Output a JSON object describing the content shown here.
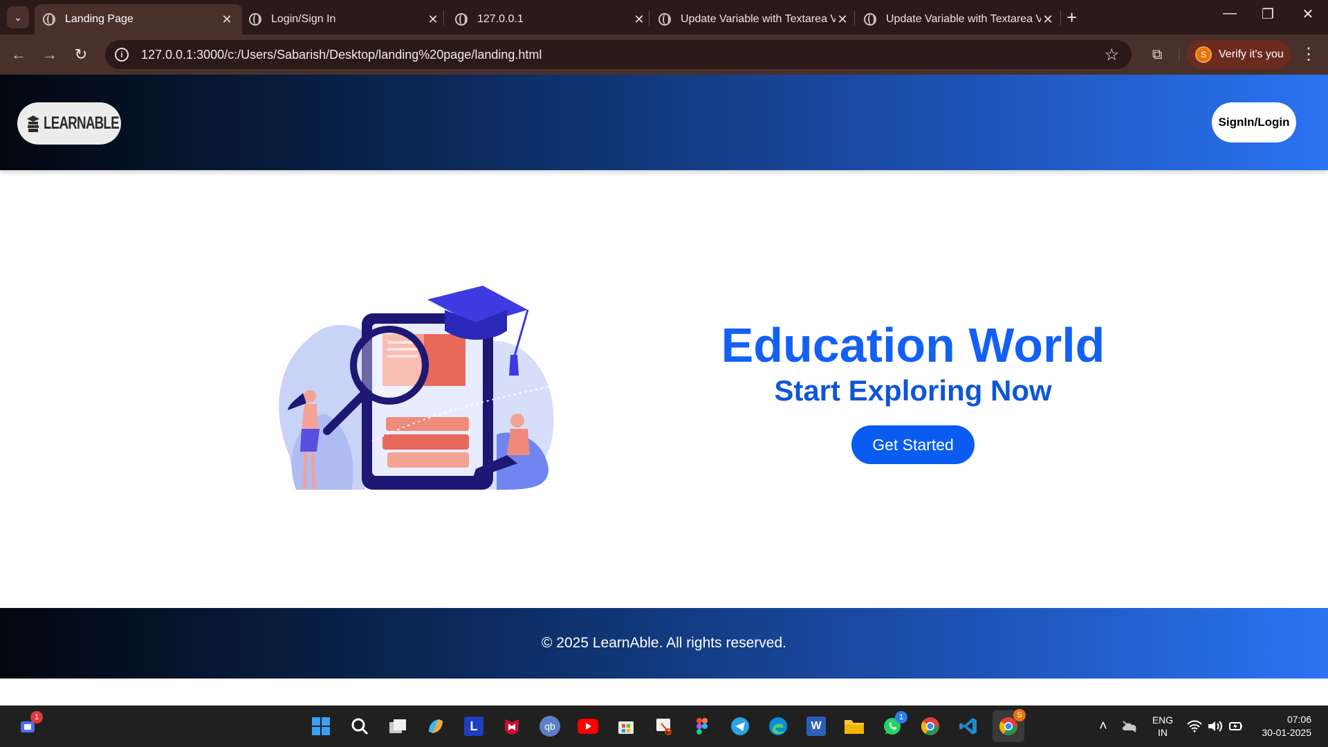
{
  "browser": {
    "tabs": [
      {
        "title": "Landing Page",
        "active": true
      },
      {
        "title": "Login/Sign In",
        "active": false
      },
      {
        "title": "127.0.0.1",
        "active": false
      },
      {
        "title": "Update Variable with Textarea V",
        "active": false
      },
      {
        "title": "Update Variable with Textarea V",
        "active": false
      }
    ],
    "new_tab_icon": "plus-icon",
    "url": "127.0.0.1:3000/c:/Users/Sabarish/Desktop/landing%20page/landing.html",
    "verify_label": "Verify it's you",
    "profile_initial": "S"
  },
  "page": {
    "logo_text": "LEARNABLE",
    "signin_label": "SignIn/Login",
    "hero_title": "Education World",
    "hero_subtitle": "Start Exploring Now",
    "cta_label": "Get Started",
    "footer_text": "© 2025 LearnAble. All rights reserved."
  },
  "taskbar": {
    "apps": [
      {
        "name": "teams",
        "badge": "1"
      },
      {
        "name": "start"
      },
      {
        "name": "search"
      },
      {
        "name": "task-view"
      },
      {
        "name": "copilot"
      },
      {
        "name": "l-app",
        "label": "L"
      },
      {
        "name": "mcafee"
      },
      {
        "name": "qbittorrent",
        "label": "qb"
      },
      {
        "name": "youtube"
      },
      {
        "name": "store"
      },
      {
        "name": "snipping-tool"
      },
      {
        "name": "figma"
      },
      {
        "name": "telegram"
      },
      {
        "name": "edge"
      },
      {
        "name": "word",
        "label": "W"
      },
      {
        "name": "file-explorer"
      },
      {
        "name": "whatsapp",
        "badge": "1"
      },
      {
        "name": "chrome"
      },
      {
        "name": "vscode"
      },
      {
        "name": "chrome-profile",
        "badge": "S"
      }
    ],
    "language": "ENG",
    "region": "IN",
    "time": "07:06",
    "date": "30-01-2025"
  },
  "colors": {
    "accent": "#1260f5",
    "button": "#0a5cf0",
    "header_gradient_start": "#02070f",
    "header_gradient_end": "#2a73f2"
  }
}
